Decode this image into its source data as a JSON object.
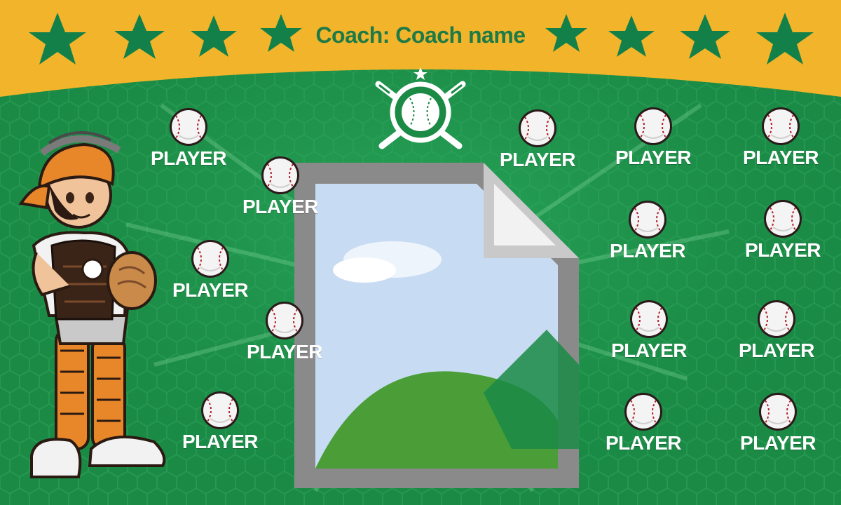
{
  "header": {
    "coach_text": "Coach: Coach name",
    "star_count": 8
  },
  "players": [
    {
      "label": "PLAYER",
      "side": "left"
    },
    {
      "label": "PLAYER",
      "side": "left"
    },
    {
      "label": "PLAYER",
      "side": "left"
    },
    {
      "label": "PLAYER",
      "side": "left"
    },
    {
      "label": "PLAYER",
      "side": "left"
    },
    {
      "label": "PLAYER",
      "side": "center"
    },
    {
      "label": "PLAYER",
      "side": "right"
    },
    {
      "label": "PLAYER",
      "side": "right"
    },
    {
      "label": "PLAYER",
      "side": "right"
    },
    {
      "label": "PLAYER",
      "side": "right"
    },
    {
      "label": "PLAYER",
      "side": "right"
    },
    {
      "label": "PLAYER",
      "side": "right"
    },
    {
      "label": "PLAYER",
      "side": "right"
    },
    {
      "label": "PLAYER",
      "side": "right"
    }
  ],
  "colors": {
    "banner_yellow": "#f2b42a",
    "field_green": "#1a8a45",
    "star_green": "#13804a",
    "stitch_red": "#b3202a",
    "catcher_orange": "#e8862a"
  },
  "icons": {
    "crest": "crossed-bats-baseball-emblem",
    "mascot": "baseball-catcher-mascot",
    "photo": "broken-image-placeholder-icon"
  }
}
